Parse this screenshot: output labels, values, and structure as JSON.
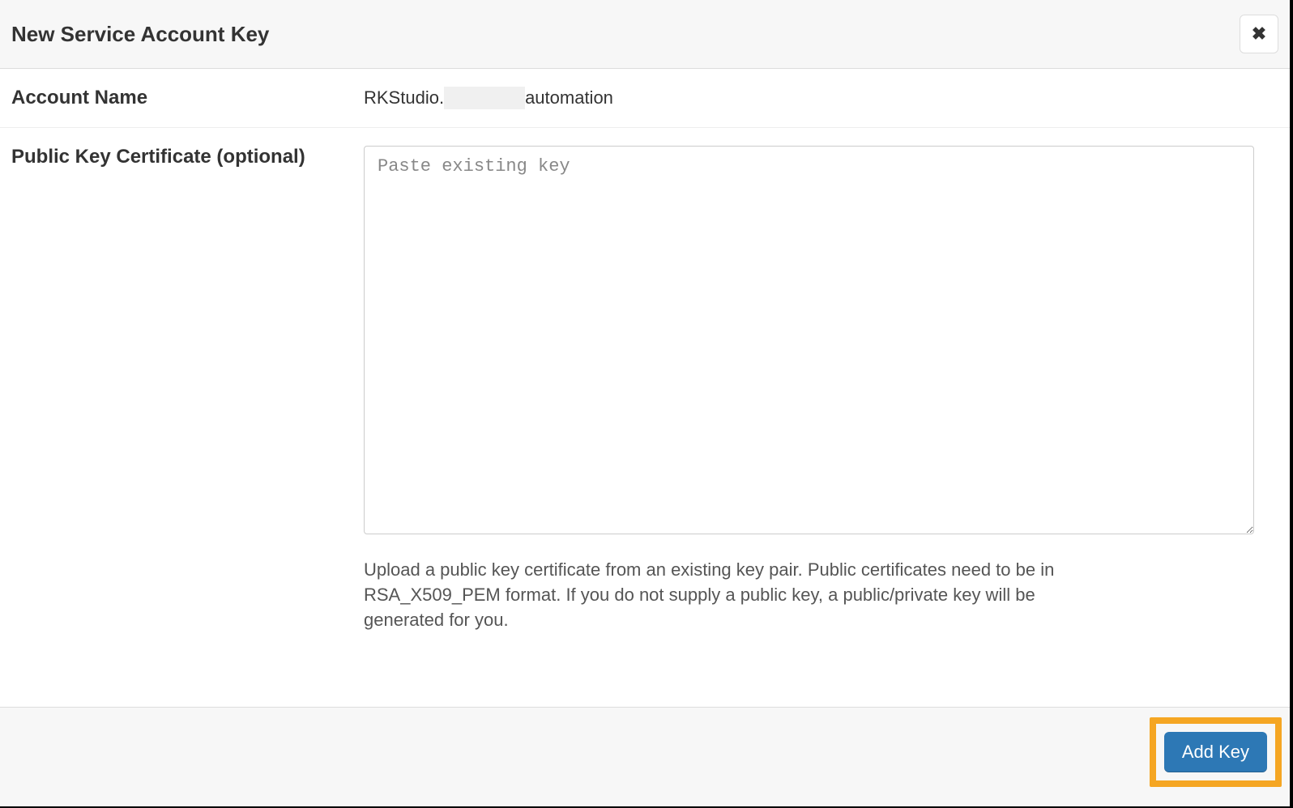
{
  "header": {
    "title": "New Service Account Key"
  },
  "accountName": {
    "label": "Account Name",
    "prefix": "RKStudio.",
    "suffix": "automation"
  },
  "publicKey": {
    "label": "Public Key Certificate (optional)",
    "placeholder": "Paste existing key",
    "helpText": "Upload a public key certificate from an existing key pair. Public certificates need to be in RSA_X509_PEM format. If you do not supply a public key, a public/private key will be generated for you."
  },
  "footer": {
    "addKeyLabel": "Add Key"
  }
}
